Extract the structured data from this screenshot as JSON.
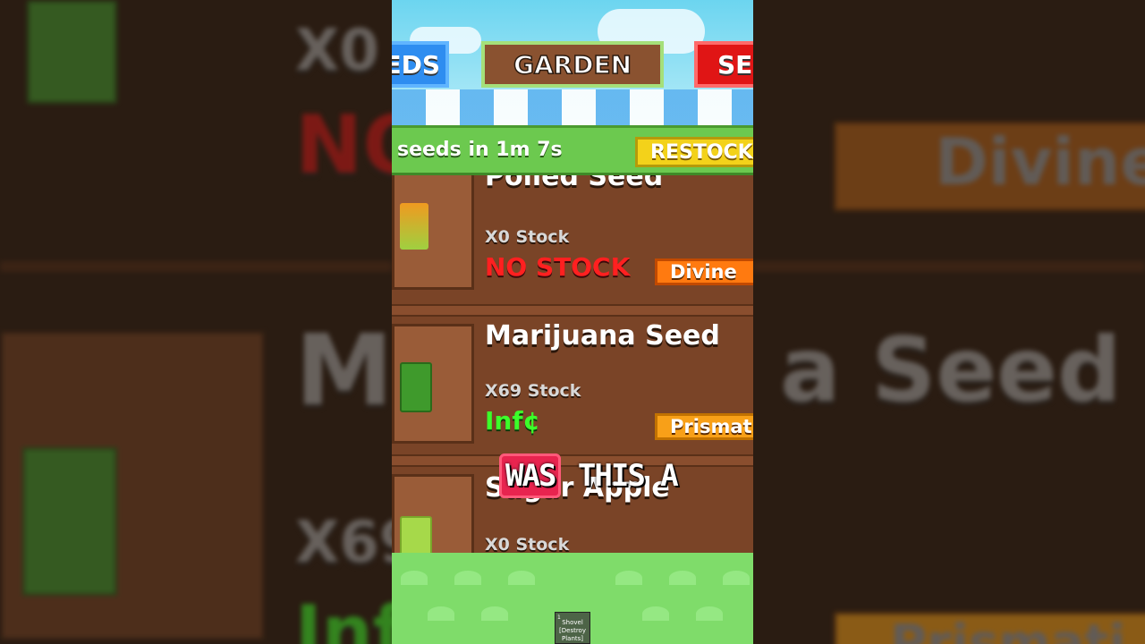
{
  "tabs": {
    "seeds": "EDS",
    "garden": "GARDEN",
    "sell": "SE"
  },
  "restock": {
    "timer_text": "seeds in 1m 7s",
    "button": "RESTOCK"
  },
  "items": [
    {
      "name": "Polled Seed",
      "stock": "X0 Stock",
      "price": "NO STOCK",
      "rarity": "Divine"
    },
    {
      "name": "Marijuana Seed",
      "stock": "X69 Stock",
      "price": "Inf¢",
      "rarity": "Prismati"
    },
    {
      "name": "Sugar Apple",
      "stock": "X0 Stock"
    }
  ],
  "hotbar": {
    "slot_number": "1",
    "label": "Shovel [Destroy Plants]"
  },
  "caption": {
    "word1": "WAS",
    "rest": "THIS A"
  },
  "background": {
    "left_big1": "X0",
    "left_big2": "NO",
    "left_big3": "X69",
    "left_big4": "Inf",
    "right_big1": "Divine",
    "right_big2": "a Seed",
    "right_big3": "Prismati",
    "left_m": "M"
  },
  "colors": {
    "divine": "#ff7a10",
    "prismatic": "#f8a018",
    "no_stock": "#ff2020",
    "inf_price": "#3cff2a",
    "restock_button": "#f3d21a",
    "caption_highlight": "#e8244f"
  }
}
